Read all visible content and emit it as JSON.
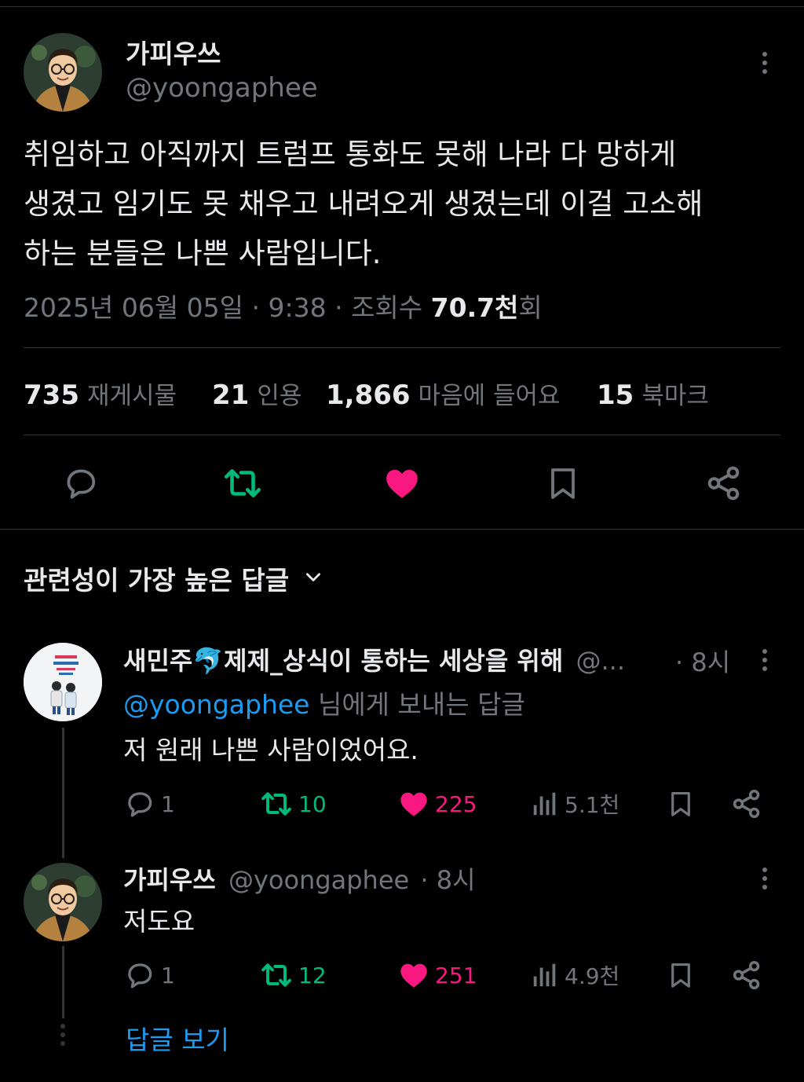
{
  "main_tweet": {
    "display_name": "가피우쓰",
    "handle": "@yoongaphee",
    "text_lines": [
      "취임하고 아직까지 트럼프 통화도 못해 나라 다 망하게",
      "생겼고 임기도 못 채우고 내려오게 생겼는데 이걸 고소해",
      "하는 분들은 나쁜 사람입니다."
    ],
    "meta_date": "2025년 06월 05일 · 9:38 · 조회수 ",
    "views_num": "70.7천",
    "views_suffix": "회",
    "stats": {
      "retweets_num": "735",
      "retweets_lbl": "재게시물",
      "quotes_num": "21",
      "quotes_lbl": "인용",
      "likes_num": "1,866",
      "likes_lbl": "마음에 들어요",
      "bookmarks_num": "15",
      "bookmarks_lbl": "북마크"
    }
  },
  "replies_sort": {
    "label": "관련성이 가장 높은 답글"
  },
  "reply1": {
    "display_name": "새민주🐬제제_상식이 통하는 세상을 위해",
    "handle_trunc": "@...",
    "time": "· 8시",
    "replying_to_handle": "@yoongaphee",
    "replying_to_suffix": " 님에게 보내는 답글",
    "text": "저 원래 나쁜 사람이었어요.",
    "reply_count": "1",
    "retweet_count": "10",
    "like_count": "225",
    "view_count": "5.1천"
  },
  "reply2": {
    "display_name": "가피우쓰",
    "handle": "@yoongaphee",
    "time": "· 8시",
    "text": "저도요",
    "reply_count": "1",
    "retweet_count": "12",
    "like_count": "251",
    "view_count": "4.9천"
  },
  "show_replies": {
    "label": "답글 보기"
  },
  "colors": {
    "background": "#000000",
    "text": "#e7e9ea",
    "muted": "#71767b",
    "retweet_green": "#00ba7c",
    "like_pink": "#f91880",
    "link_blue": "#1d9bf0",
    "divider": "#2f3336"
  }
}
